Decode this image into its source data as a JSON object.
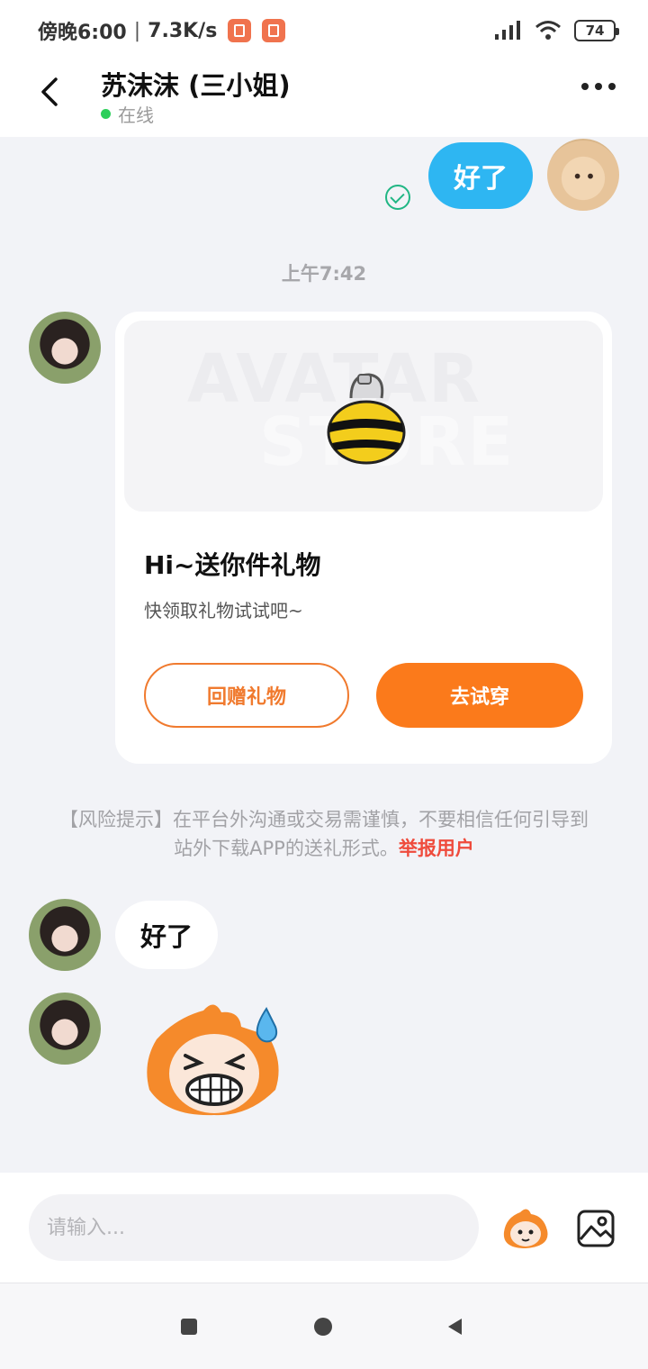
{
  "status_bar": {
    "time": "傍晚6:00",
    "separator": "|",
    "net_speed": "7.3K/s",
    "battery": "74",
    "icons": [
      "notification-icon",
      "notification-icon",
      "signal-icon",
      "wifi-icon",
      "battery-icon"
    ]
  },
  "header": {
    "contact_name": "苏沫沫 (三小姐)",
    "status": "在线",
    "status_color": "#2ccf5a",
    "icons": [
      "back-arrow-icon",
      "more-icon"
    ]
  },
  "messages": {
    "outgoing_text": "好了",
    "outgoing_bubble_color": "#2eb6f2",
    "read_receipt_icon": "check-circle-icon",
    "time_label": "上午7:42",
    "gift_card": {
      "watermark": "AVATAR",
      "watermark_line2": "STORE",
      "title": "Hi~送你件礼物",
      "subtitle": "快领取礼物试试吧~",
      "return_button": "回赠礼物",
      "tryon_button": "去试穿",
      "accent_color": "#fb7a1b"
    },
    "risk_notice": {
      "text": "【风险提示】在平台外沟通或交易需谨慎，不要相信任何引导到站外下载APP的送礼形式。",
      "link": "举报用户",
      "link_color": "#ef4b3c"
    },
    "incoming_text": "好了",
    "sticker_icon": "nervous-sticker"
  },
  "input_bar": {
    "placeholder": "请输入...",
    "value": "",
    "icons": [
      "emoji-sticker-icon",
      "image-icon"
    ]
  },
  "nav_bar": {
    "icons": [
      "recents-icon",
      "home-icon",
      "back-icon"
    ]
  }
}
